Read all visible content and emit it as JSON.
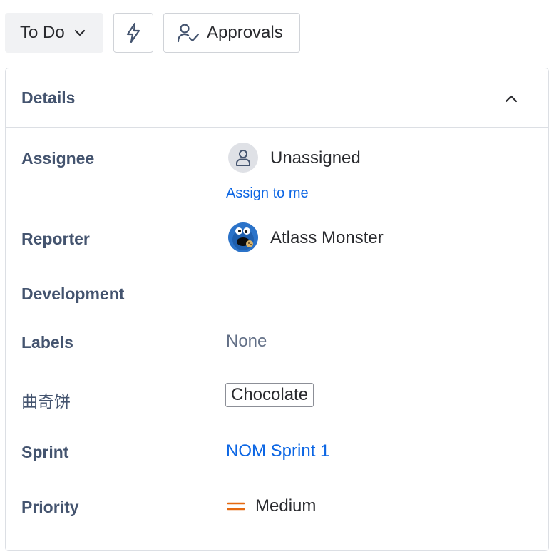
{
  "toolbar": {
    "status_label": "To Do",
    "approvals_label": "Approvals"
  },
  "details": {
    "title": "Details",
    "fields": {
      "assignee": {
        "label": "Assignee",
        "value": "Unassigned",
        "action": "Assign to me"
      },
      "reporter": {
        "label": "Reporter",
        "value": "Atlass Monster"
      },
      "development": {
        "label": "Development"
      },
      "labels": {
        "label": "Labels",
        "value": "None"
      },
      "custom": {
        "label": "曲奇饼",
        "value": "Chocolate"
      },
      "sprint": {
        "label": "Sprint",
        "value": "NOM Sprint 1"
      },
      "priority": {
        "label": "Priority",
        "value": "Medium",
        "color": "#e56910"
      }
    }
  },
  "icons": {
    "status_chevron": "chevron-down-icon",
    "automation": "lightning-icon",
    "approvals": "user-check-icon",
    "collapse": "chevron-up-icon",
    "assignee_avatar": "person-icon",
    "priority": "priority-medium-icon"
  }
}
